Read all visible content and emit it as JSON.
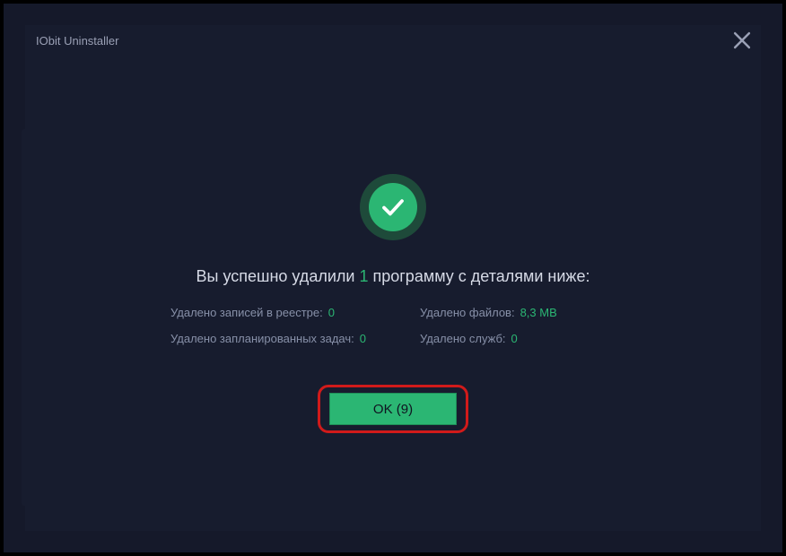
{
  "window": {
    "title": "IObit Uninstaller"
  },
  "success": {
    "headline_pre": "Вы успешно удалили ",
    "count": "1",
    "headline_post": " программу с деталями ниже:"
  },
  "details": {
    "registry_label": "Удалено записей в реестре:",
    "registry_value": "0",
    "files_label": "Удалено файлов:",
    "files_value": "8,3 MB",
    "tasks_label": "Удалено запланированных задач:",
    "tasks_value": "0",
    "services_label": "Удалено служб:",
    "services_value": "0"
  },
  "buttons": {
    "ok_label": "OK (9)"
  },
  "colors": {
    "accent": "#2bb673",
    "highlight_border": "#d11a1a",
    "background": "#171c2e"
  }
}
